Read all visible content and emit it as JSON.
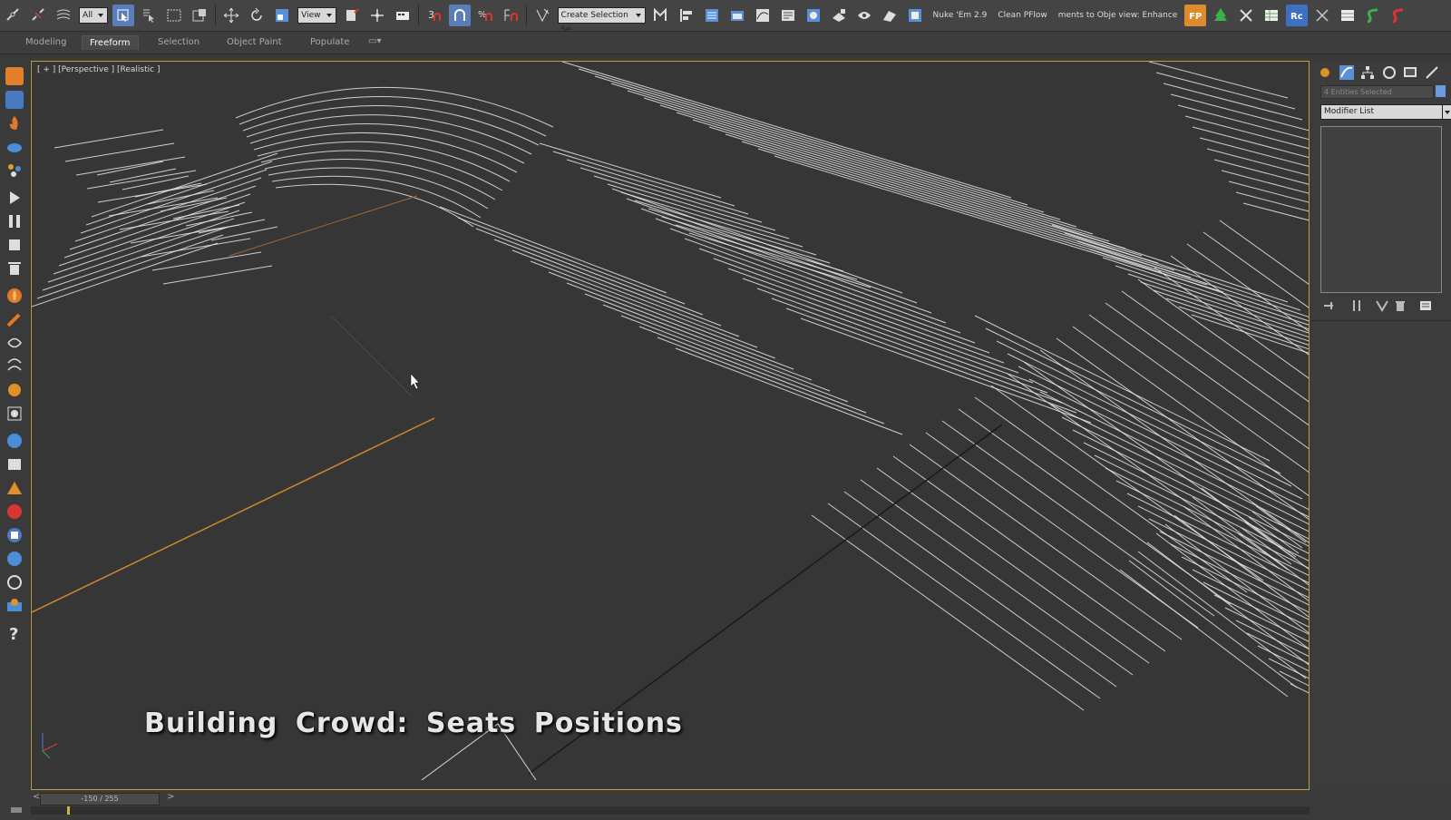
{
  "toolbar": {
    "selection_filter": "All",
    "ref_coord": "View",
    "named_selection": "Create Selection Se",
    "script_nukem": "Nuke 'Em 2.9",
    "script_cleanpflow": "Clean PFlow",
    "script_enhance": "ments to Obje view: Enhance",
    "icons": [
      "link-icon",
      "unlink-icon",
      "bind-spacewarp-icon",
      "select-object-icon",
      "select-by-name-icon",
      "rect-region-icon",
      "window-crossing-icon",
      "move-icon",
      "rotate-icon",
      "scale-icon",
      "pivot-icon",
      "keyboard-shortcut-icon",
      "snap-icon",
      "angle-snap-icon",
      "percent-snap-icon",
      "spinner-snap-icon",
      "edit-named-sel-icon",
      "mirror-icon",
      "align-icon",
      "layer-icon",
      "scene-explorer-icon",
      "curve-editor-icon",
      "schematic-icon",
      "material-editor-icon",
      "render-setup-icon",
      "rendered-frame-icon",
      "render-icon",
      "render-iterative-icon"
    ]
  },
  "ribbon": {
    "tabs": [
      "Modeling",
      "Freeform",
      "Selection",
      "Object Paint",
      "Populate"
    ],
    "active_tab": "Freeform"
  },
  "viewport": {
    "label": "[ + ] [Perspective ] [Realistic ]",
    "caption": "Building Crowd: Seats Positions"
  },
  "command_panel": {
    "selection_info": "4 Entities Selected",
    "modifier_list": "Modifier List"
  },
  "timeline": {
    "frame": "-150 / 255"
  },
  "colors": {
    "viewport_border": "#b8a23c",
    "toolbar_active": "#5a7fb8",
    "seat_lines": "#e8e8e8",
    "guide_line": "#d4862a"
  }
}
